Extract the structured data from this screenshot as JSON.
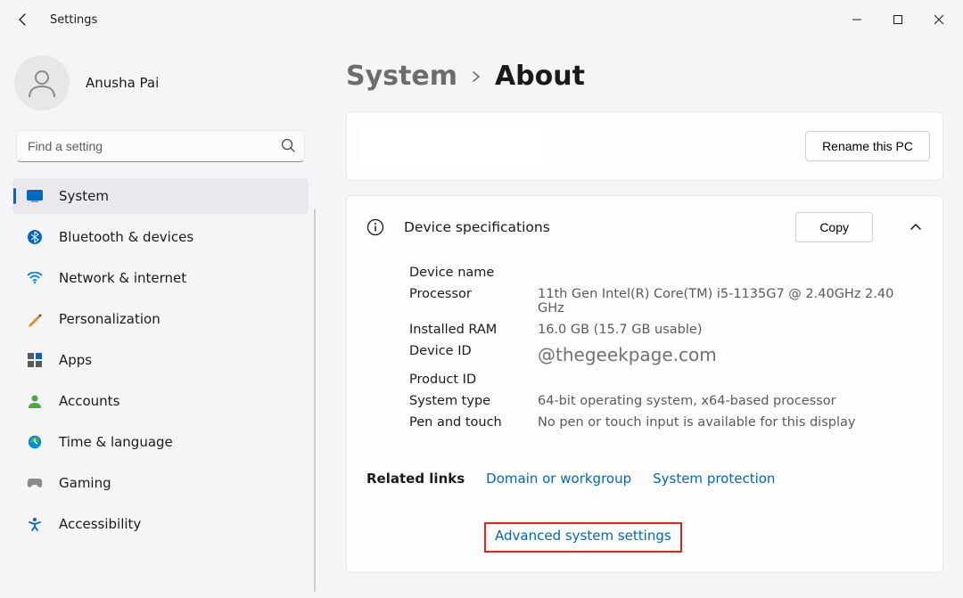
{
  "window": {
    "title": "Settings"
  },
  "user": {
    "name": "Anusha Pai"
  },
  "search": {
    "placeholder": "Find a setting"
  },
  "sidebar": {
    "items": [
      {
        "label": "System",
        "icon": "system"
      },
      {
        "label": "Bluetooth & devices",
        "icon": "bluetooth"
      },
      {
        "label": "Network & internet",
        "icon": "wifi"
      },
      {
        "label": "Personalization",
        "icon": "personalization"
      },
      {
        "label": "Apps",
        "icon": "apps"
      },
      {
        "label": "Accounts",
        "icon": "accounts"
      },
      {
        "label": "Time & language",
        "icon": "time"
      },
      {
        "label": "Gaming",
        "icon": "gaming"
      },
      {
        "label": "Accessibility",
        "icon": "accessibility"
      }
    ]
  },
  "breadcrumb": {
    "parent": "System",
    "current": "About"
  },
  "rename": {
    "button": "Rename this PC"
  },
  "specs": {
    "title": "Device specifications",
    "copy": "Copy",
    "rows": {
      "device_name_label": "Device name",
      "processor_label": "Processor",
      "processor_value": "11th Gen Intel(R) Core(TM) i5-1135G7 @ 2.40GHz   2.40 GHz",
      "ram_label": "Installed RAM",
      "ram_value": "16.0 GB (15.7 GB usable)",
      "device_id_label": "Device ID",
      "watermark": "@thegeekpage.com",
      "product_id_label": "Product ID",
      "system_type_label": "System type",
      "system_type_value": "64-bit operating system, x64-based processor",
      "pen_touch_label": "Pen and touch",
      "pen_touch_value": "No pen or touch input is available for this display"
    }
  },
  "related": {
    "label": "Related links",
    "domain": "Domain or workgroup",
    "protection": "System protection",
    "advanced": "Advanced system settings"
  }
}
